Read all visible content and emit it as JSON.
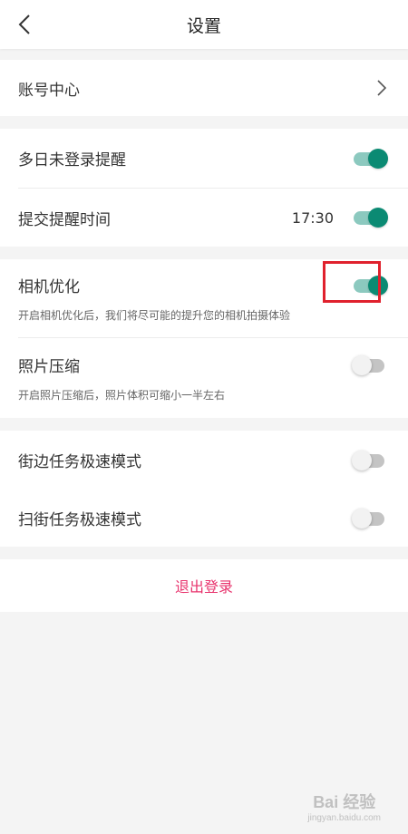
{
  "header": {
    "title": "设置",
    "back_icon": "chevron-left-icon"
  },
  "account": {
    "label": "账号中心",
    "arrow_icon": "chevron-right-icon"
  },
  "reminders": {
    "multi_day": {
      "label": "多日未登录提醒",
      "enabled": true
    },
    "submit_time": {
      "label": "提交提醒时间",
      "time": "17:30",
      "enabled": true
    }
  },
  "camera": {
    "label": "相机优化",
    "description": "开启相机优化后，我们将尽可能的提升您的相机拍摄体验",
    "enabled": true
  },
  "photo": {
    "label": "照片压缩",
    "description": "开启照片压缩后，照片体积可缩小一半左右",
    "enabled": false
  },
  "modes": {
    "street_side": {
      "label": "街边任务极速模式",
      "enabled": false
    },
    "street_scan": {
      "label": "扫街任务极速模式",
      "enabled": false
    }
  },
  "logout": {
    "label": "退出登录"
  },
  "watermark": {
    "main": "Bai 经验",
    "sub": "jingyan.baidu.com"
  },
  "colors": {
    "toggle_on": "#0b8a73",
    "toggle_on_track": "#8cc9bf",
    "toggle_off_track": "#c4c4c4",
    "logout_text": "#e8336d",
    "highlight_border": "#e0212d"
  }
}
